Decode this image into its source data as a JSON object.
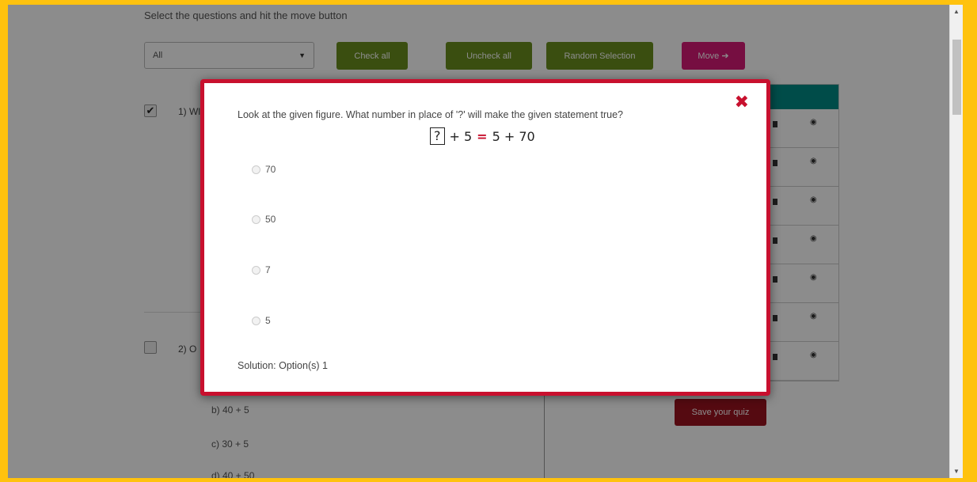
{
  "page": {
    "instruction": "Select the questions and hit the move button",
    "filter": {
      "value": "All"
    },
    "buttons": {
      "check_all": "Check all",
      "uncheck_all": "Uncheck all",
      "random_selection": "Random Selection",
      "move": "Move ➔",
      "save_quiz": "Save your quiz"
    },
    "questions": [
      {
        "label": "1) Wl",
        "checked": true
      },
      {
        "label": "2) O",
        "checked": false
      }
    ],
    "visible_options": [
      "b) 40 + 5",
      "c) 30 + 5",
      "d) 40 + 50"
    ]
  },
  "modal": {
    "question": "Look at the given figure. What number in place of '?' will make the given statement true?",
    "equation": {
      "box": "?",
      "left_rest": "+ 5",
      "equals": "=",
      "right": "5 + 70"
    },
    "options": [
      "70",
      "50",
      "7",
      "5"
    ],
    "solution": "Solution: Option(s) 1",
    "close_symbol": "✖"
  },
  "colors": {
    "border_frame": "#ffc20e",
    "green_button": "#6a8e1e",
    "move_button": "#d81b77",
    "save_button": "#9c1320",
    "modal_border": "#c8102e",
    "panel_header": "#008b86"
  },
  "icons": [
    "chevron-down-icon",
    "close-icon",
    "trash-icon",
    "eye-icon",
    "arrow-right-icon"
  ]
}
